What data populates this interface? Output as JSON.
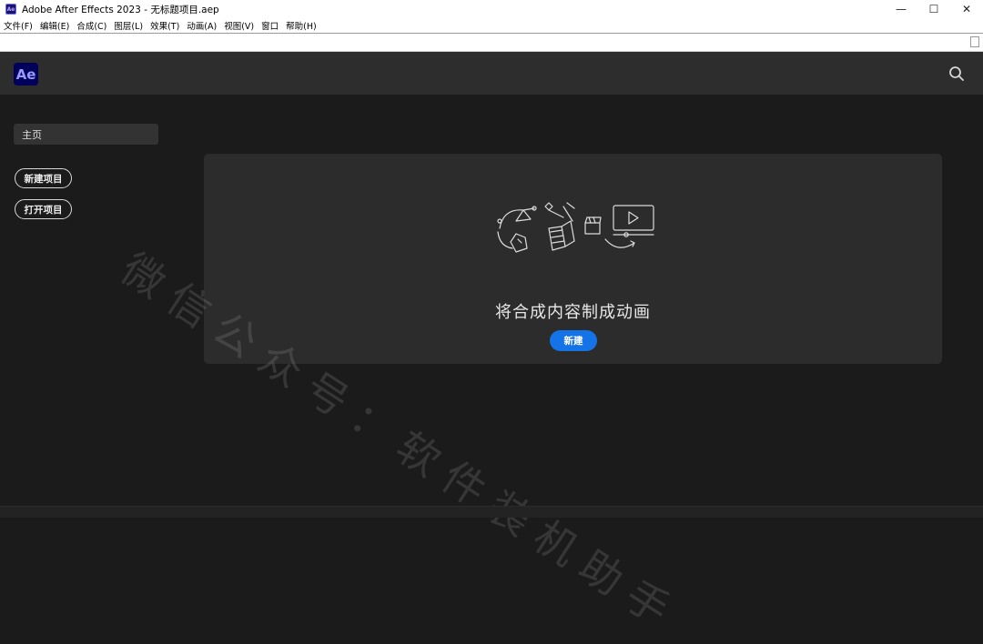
{
  "window": {
    "app_icon_text": "Ae",
    "title": "Adobe After Effects 2023 - 无标题项目.aep",
    "controls": {
      "minimize": "—",
      "maximize": "☐",
      "close": "✕"
    }
  },
  "menu": [
    {
      "label": "文件(F)"
    },
    {
      "label": "编辑(E)"
    },
    {
      "label": "合成(C)"
    },
    {
      "label": "图层(L)"
    },
    {
      "label": "效果(T)"
    },
    {
      "label": "动画(A)"
    },
    {
      "label": "视图(V)"
    },
    {
      "label": "窗口"
    },
    {
      "label": "帮助(H)"
    }
  ],
  "home": {
    "logo_text": "Ae",
    "search_icon": "search-icon",
    "sidebar": {
      "nav_home": "主页",
      "new_project": "新建项目",
      "open_project": "打开项目"
    },
    "panel": {
      "heading": "将合成内容制成动画",
      "new_button": "新建"
    }
  },
  "watermark": "微信公众号：软件装机助手",
  "colors": {
    "accent": "#1473e6",
    "ae_logo_bg": "#00005b",
    "ae_logo_text": "#9999ff",
    "background": "#1b1b1b",
    "panel": "#2c2c2c",
    "header": "#2d2d2d"
  }
}
